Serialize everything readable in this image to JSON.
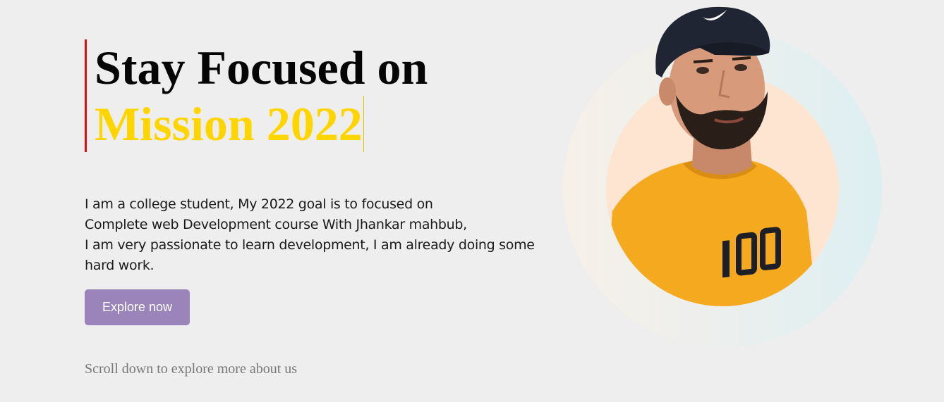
{
  "hero": {
    "headline_line1": "Stay Focused on",
    "headline_line2": "Mission 2022",
    "description_lines": [
      "I am a college student, My 2022 goal is to focused on",
      "Complete web Development course With Jhankar mahbub,",
      "I am very passionate to learn development, I am already doing some",
      "hard work."
    ],
    "button_label": "Explore now",
    "scroll_note": "Scroll down to explore more about us"
  },
  "portrait": {
    "shirt_print": "100"
  },
  "colors": {
    "background": "#eeeeee",
    "accent_bar": "#e10c0c",
    "highlight": "#ffd500",
    "button": "#9a84b9",
    "inner_circle": "#fde5d2",
    "shirt": "#f5a91e"
  }
}
